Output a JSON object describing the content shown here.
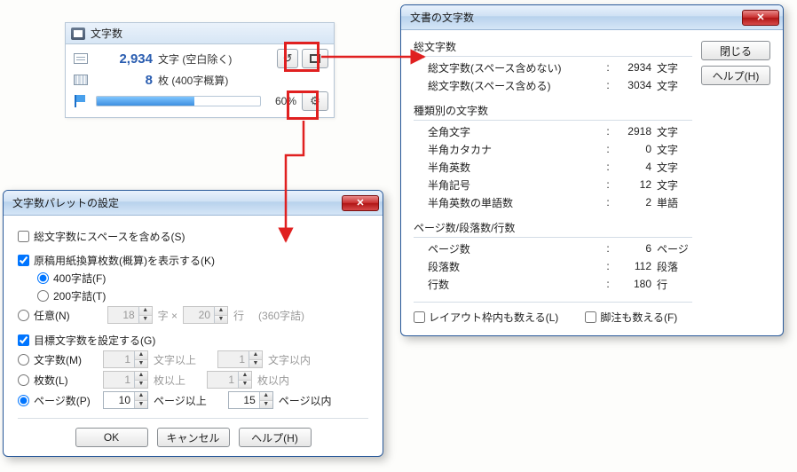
{
  "palette": {
    "title": "文字数",
    "char_count": "2,934",
    "char_label": "文字 (空白除く)",
    "sheet_count": "8",
    "sheet_label": "枚 (400字概算)",
    "progress_pct": "60%"
  },
  "stats_dialog": {
    "title": "文書の文字数",
    "close_btn": "閉じる",
    "help_btn": "ヘルプ(H)",
    "groups": {
      "total": {
        "title": "総文字数",
        "rows": [
          {
            "label": "総文字数(スペース含めない)",
            "val": "2934",
            "unit": "文字"
          },
          {
            "label": "総文字数(スペース含める)",
            "val": "3034",
            "unit": "文字"
          }
        ]
      },
      "by_type": {
        "title": "種類別の文字数",
        "rows": [
          {
            "label": "全角文字",
            "val": "2918",
            "unit": "文字"
          },
          {
            "label": "半角カタカナ",
            "val": "0",
            "unit": "文字"
          },
          {
            "label": "半角英数",
            "val": "4",
            "unit": "文字"
          },
          {
            "label": "半角記号",
            "val": "12",
            "unit": "文字"
          },
          {
            "label": "半角英数の単語数",
            "val": "2",
            "unit": "単語"
          }
        ]
      },
      "pages": {
        "title": "ページ数/段落数/行数",
        "rows": [
          {
            "label": "ページ数",
            "val": "6",
            "unit": "ページ"
          },
          {
            "label": "段落数",
            "val": "112",
            "unit": "段落"
          },
          {
            "label": "行数",
            "val": "180",
            "unit": "行"
          }
        ]
      }
    },
    "checks": {
      "layout": "レイアウト枠内も数える(L)",
      "footnote": "脚注も数える(F)"
    }
  },
  "settings_dialog": {
    "title": "文字数パレットの設定",
    "total_include_space": "総文字数にスペースを含める(S)",
    "show_sheets": "原稿用紙換算枚数(概算)を表示する(K)",
    "opt_400": "400字詰(F)",
    "opt_200": "200字詰(T)",
    "opt_any": "任意(N)",
    "any_cols": "18",
    "any_cols_suffix": "字 ×",
    "any_rows": "20",
    "any_rows_suffix": "行",
    "any_hint": "(360字詰)",
    "set_target": "目標文字数を設定する(G)",
    "target_chars": "文字数(M)",
    "target_chars_min": "1",
    "target_chars_min_suffix": "文字以上",
    "target_chars_max": "1",
    "target_chars_max_suffix": "文字以内",
    "target_sheets": "枚数(L)",
    "target_sheets_min": "1",
    "target_sheets_min_suffix": "枚以上",
    "target_sheets_max": "1",
    "target_sheets_max_suffix": "枚以内",
    "target_pages": "ページ数(P)",
    "target_pages_min": "10",
    "target_pages_min_suffix": "ページ以上",
    "target_pages_max": "15",
    "target_pages_max_suffix": "ページ以内",
    "ok": "OK",
    "cancel": "キャンセル",
    "help": "ヘルプ(H)"
  }
}
